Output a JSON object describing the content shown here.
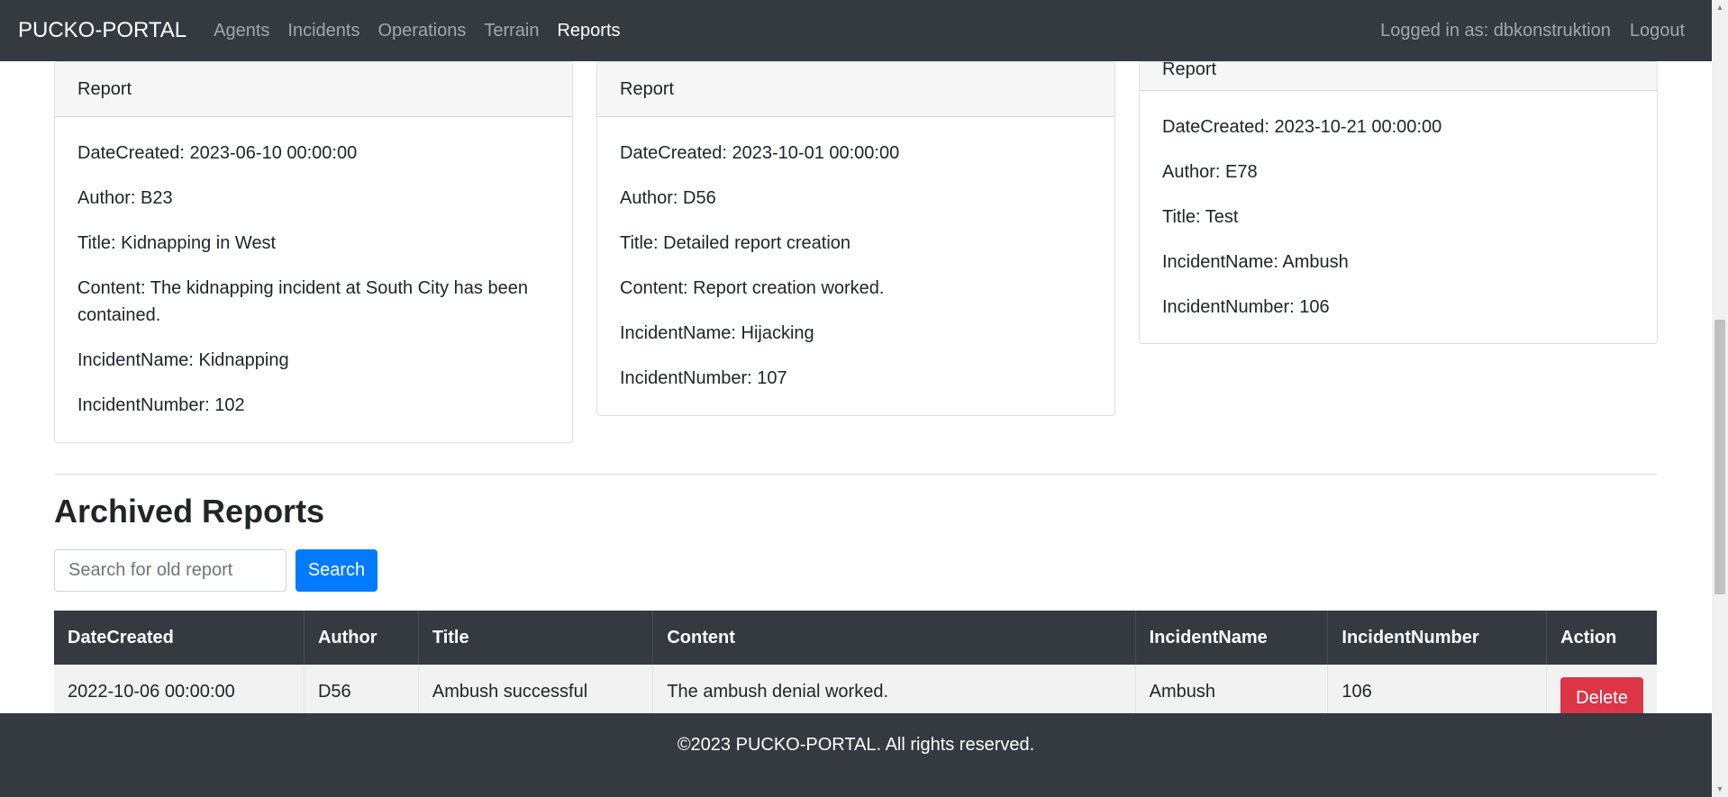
{
  "navbar": {
    "brand": "PUCKO-PORTAL",
    "links": [
      {
        "label": "Agents",
        "active": false
      },
      {
        "label": "Incidents",
        "active": false
      },
      {
        "label": "Operations",
        "active": false
      },
      {
        "label": "Terrain",
        "active": false
      },
      {
        "label": "Reports",
        "active": true
      }
    ],
    "logged_in_text": "Logged in as: dbkonstruktion",
    "logout_label": "Logout"
  },
  "reports": [
    {
      "header": "Report",
      "date_created": "DateCreated: 2023-06-10 00:00:00",
      "author": "Author: B23",
      "title": "Title: Kidnapping in West",
      "content": "Content: The kidnapping incident at South City has been contained.",
      "incident_name": "IncidentName: Kidnapping",
      "incident_number": "IncidentNumber: 102"
    },
    {
      "header": "Report",
      "date_created": "DateCreated: 2023-10-01 00:00:00",
      "author": "Author: D56",
      "title": "Title: Detailed report creation",
      "content": "Content: Report creation worked.",
      "incident_name": "IncidentName: Hijacking",
      "incident_number": "IncidentNumber: 107"
    },
    {
      "header": "Report",
      "date_created": "DateCreated: 2023-10-21 00:00:00",
      "author": "Author: E78",
      "title": "Title: Test",
      "incident_name": "IncidentName: Ambush",
      "incident_number": "IncidentNumber: 106"
    }
  ],
  "archived": {
    "heading": "Archived Reports",
    "search_placeholder": "Search for old report",
    "search_button": "Search",
    "columns": [
      "DateCreated",
      "Author",
      "Title",
      "Content",
      "IncidentName",
      "IncidentNumber",
      "Action"
    ],
    "rows": [
      {
        "date_created": "2022-10-06 00:00:00",
        "author": "D56",
        "title": "Ambush successful",
        "content": "The ambush denial worked.",
        "incident_name": "Ambush",
        "incident_number": "106",
        "action_label": "Delete"
      }
    ]
  },
  "footer": {
    "text": "©2023 PUCKO-PORTAL. All rights reserved."
  }
}
